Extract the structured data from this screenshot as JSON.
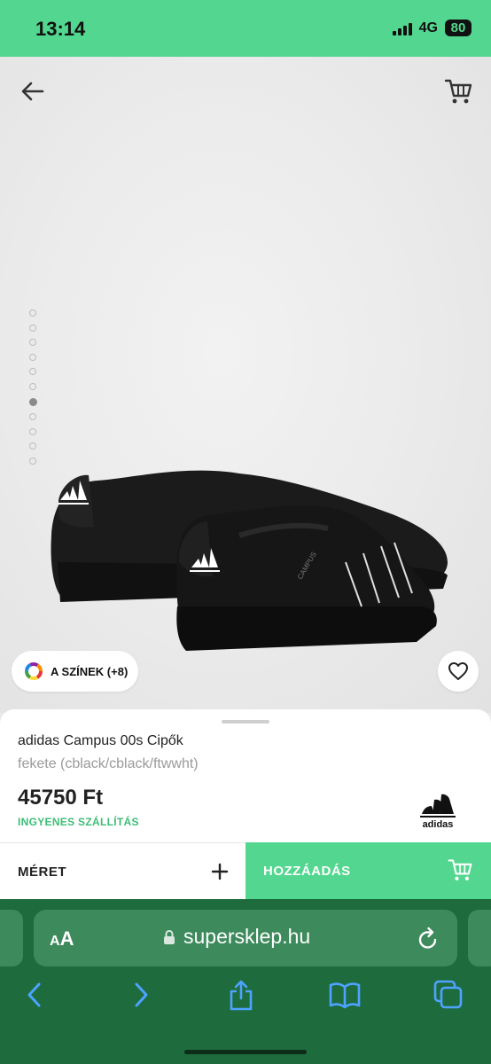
{
  "status_bar": {
    "time": "13:14",
    "network": "4G",
    "battery": "80"
  },
  "header": {
    "back_icon": "arrow-left-icon",
    "cart_icon": "cart-icon"
  },
  "gallery": {
    "image_count": 11,
    "active_index": 6
  },
  "colors_button": {
    "label": "A SZÍNEK (+8)",
    "icon": "color-wheel-icon"
  },
  "favorite_icon": "heart-icon",
  "product": {
    "name": "adidas Campus 00s Cipők",
    "color": "fekete (cblack/cblack/ftwwht)",
    "price": "45750 Ft",
    "shipping": "INGYENES SZÁLLÍTÁS",
    "brand_logo_text": "adidas"
  },
  "actions": {
    "size_label": "MÉRET",
    "add_label": "HOZZÁADÁS"
  },
  "browser": {
    "aa_small": "A",
    "aa_big": "A",
    "url": "supersklep.hu"
  },
  "colors": {
    "accent": "#53d68f",
    "browser_bg": "#1e6b3e",
    "shipping_text": "#3dbd76"
  }
}
